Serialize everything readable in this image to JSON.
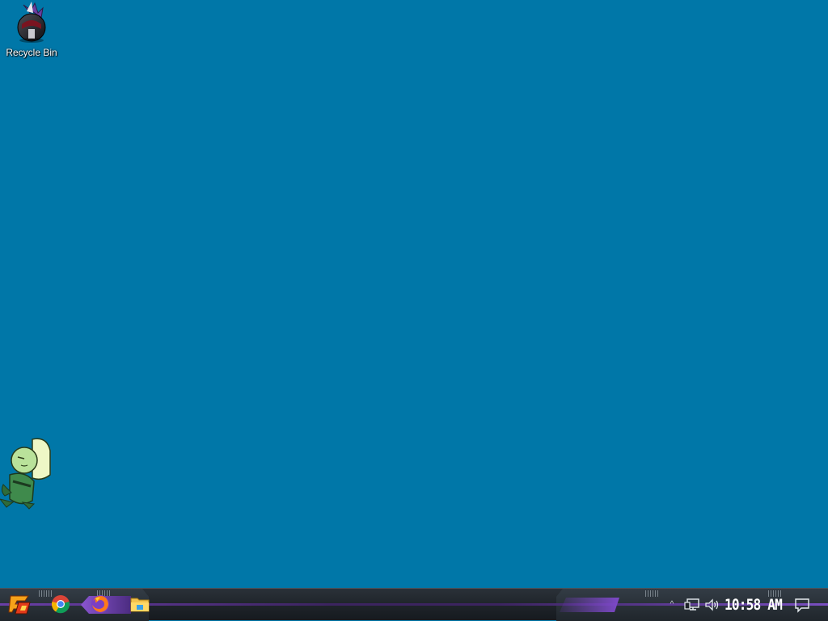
{
  "desktop": {
    "background_color": "#0077a8",
    "icons": [
      {
        "label": "Recycle Bin",
        "icon": "recycle-bin-icon"
      }
    ],
    "mascot": {
      "icon": "gem-character-icon"
    }
  },
  "taskbar": {
    "start": {
      "icon": "start-logo-icon"
    },
    "pinned": [
      {
        "icon": "chrome-icon"
      },
      {
        "icon": "firefox-icon"
      },
      {
        "icon": "file-explorer-icon"
      }
    ],
    "tray": {
      "chevron": "^",
      "network_icon": "network-icon",
      "volume_icon": "volume-icon",
      "clock": "10:58 AM",
      "action_center_icon": "action-center-icon"
    },
    "accent_color": "#7d49c8"
  }
}
